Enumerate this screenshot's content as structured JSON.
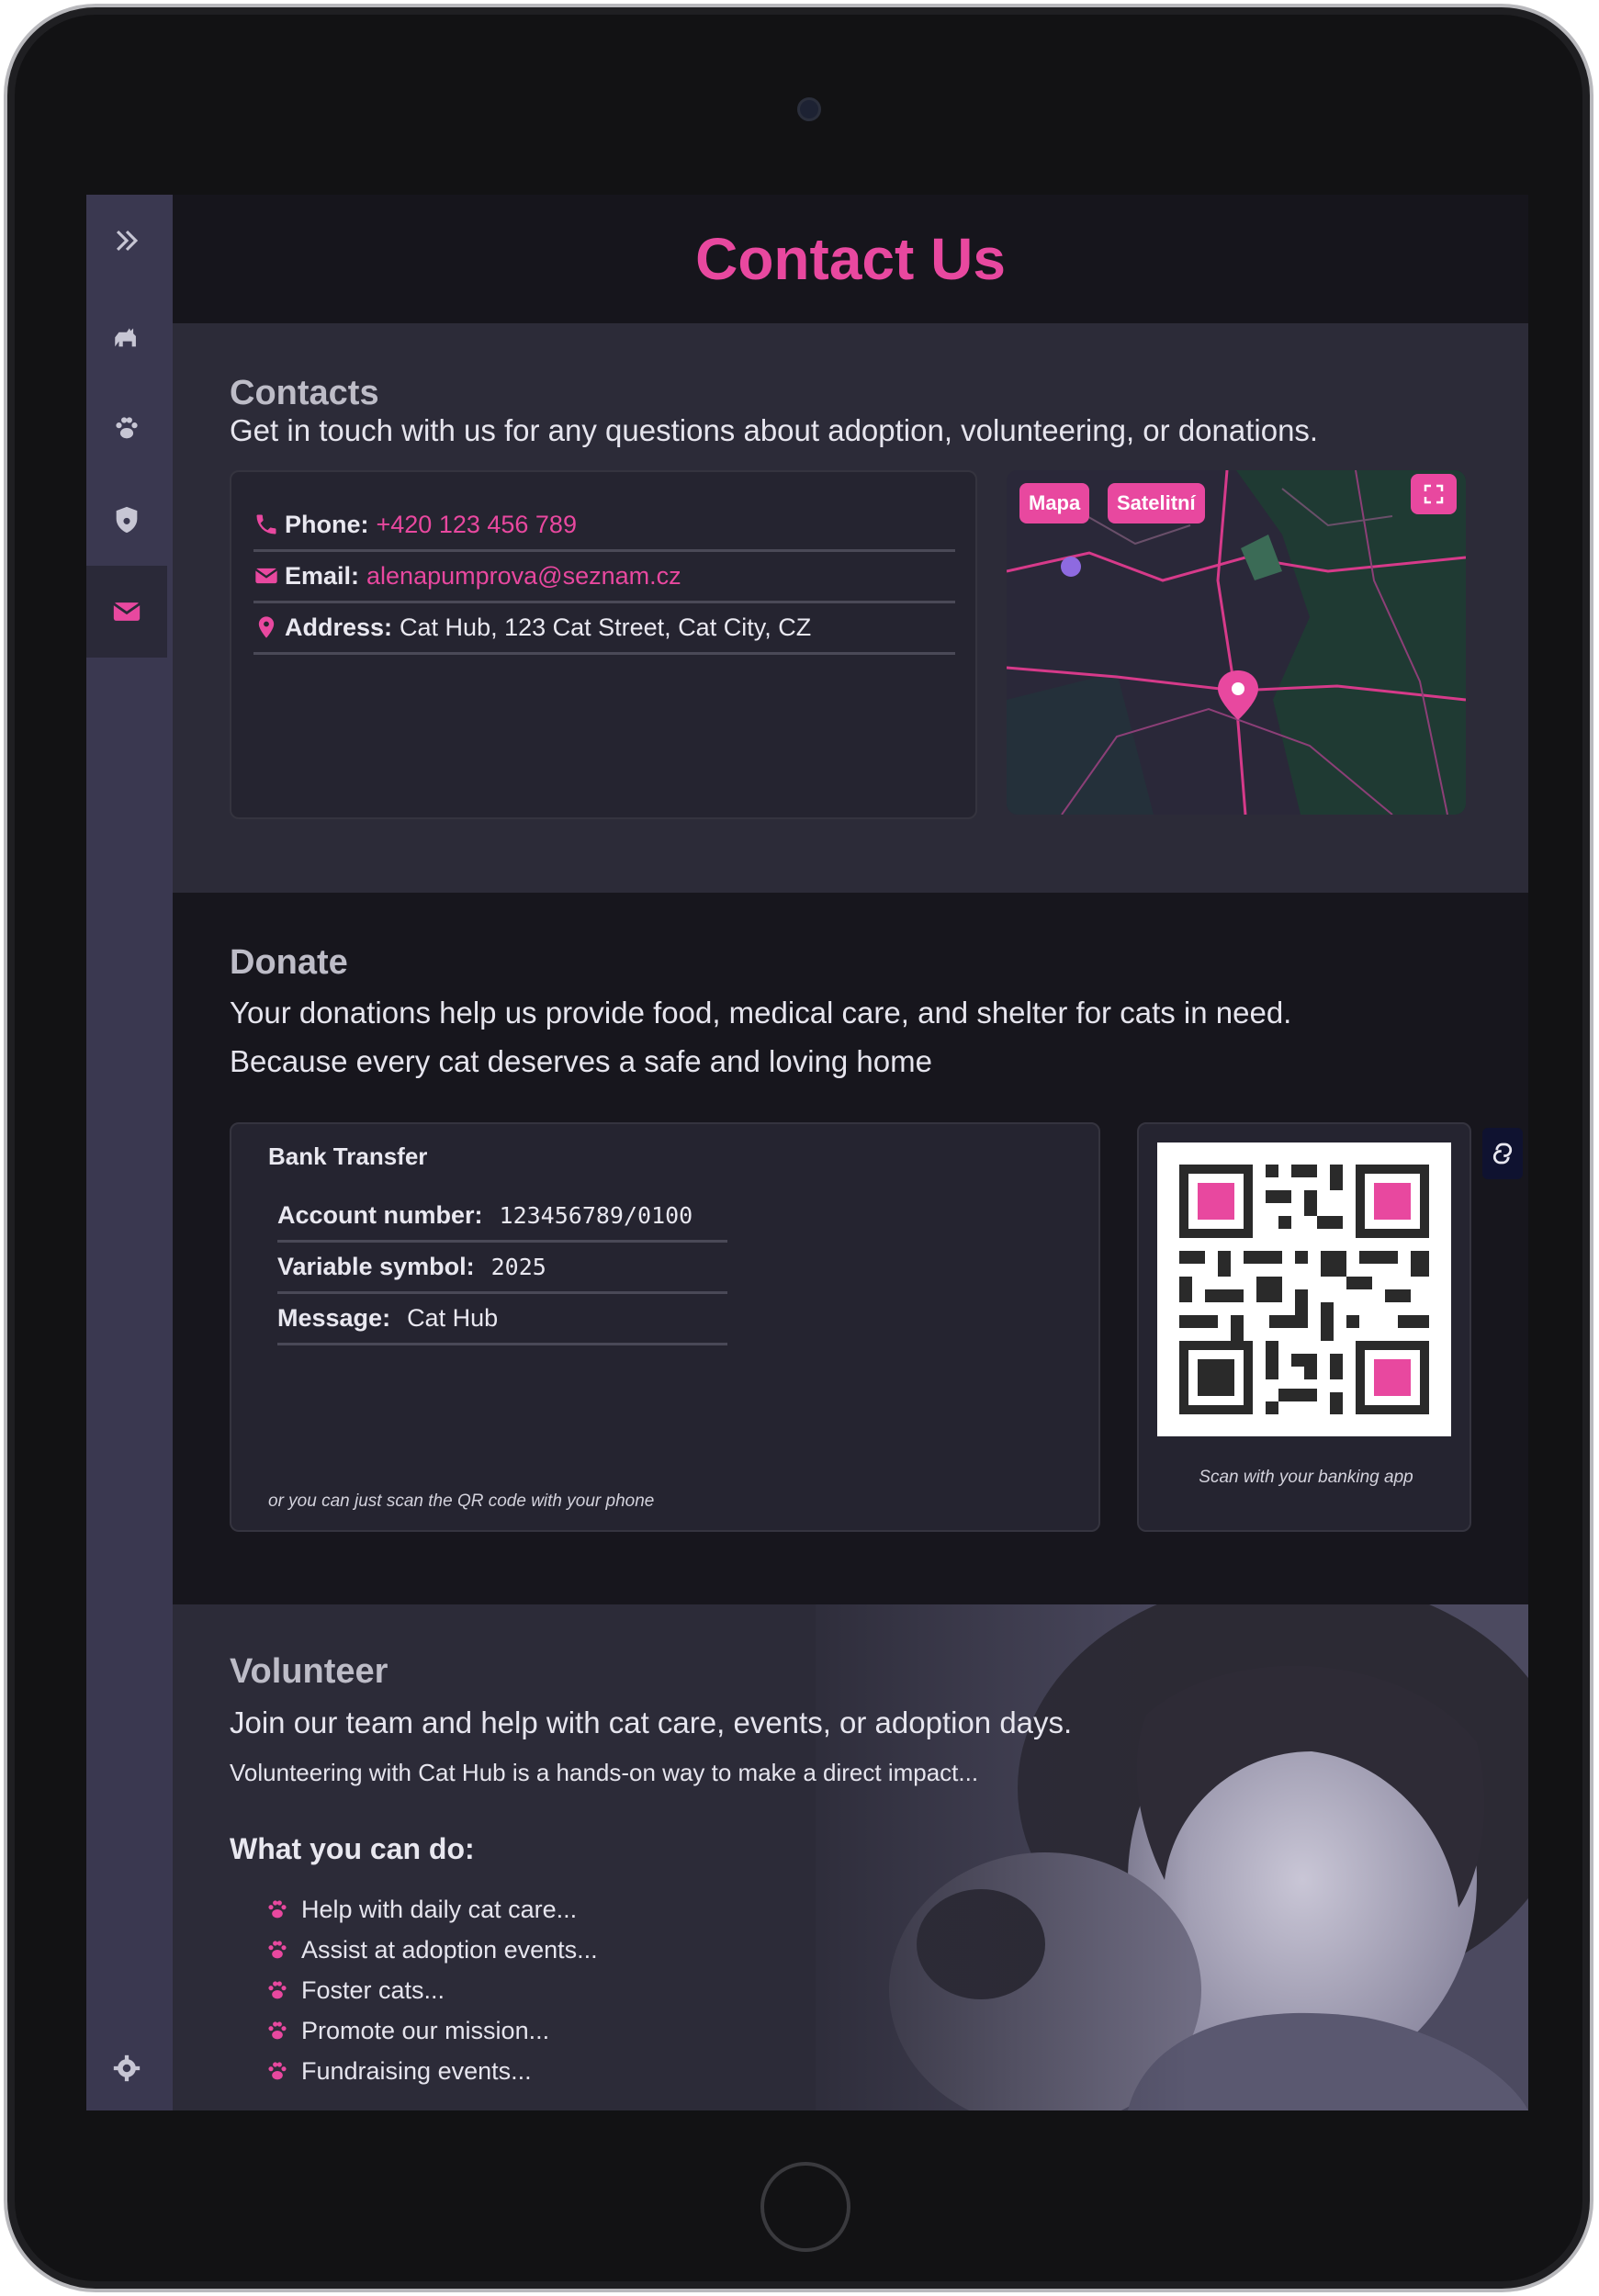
{
  "header": {
    "title": "Contact Us"
  },
  "contacts": {
    "title": "Contacts",
    "subtitle": "Get in touch with us for any questions about adoption, volunteering, or donations.",
    "phone_label": "Phone:",
    "phone_value": "+420 123 456 789",
    "email_label": "Email:",
    "email_value": "alenapumprova@seznam.cz",
    "address_label": "Address:",
    "address_value": "Cat Hub, 123 Cat Street, Cat City, CZ"
  },
  "map": {
    "btn_map": "Mapa",
    "btn_satellite": "Satelitní",
    "fullscreen_icon": "fullscreen-icon",
    "marker_icon": "paw-marker-icon"
  },
  "donate": {
    "title": "Donate",
    "line1": "Your donations help us provide food, medical care, and shelter for cats in need.",
    "line2": "Because every cat deserves a safe and loving home",
    "bank_title": "Bank Transfer",
    "account_label": "Account number:",
    "account_value": "123456789/0100",
    "vs_label": "Variable symbol:",
    "vs_value": "2025",
    "msg_label": "Message:",
    "msg_value": "Cat Hub",
    "scan_note": "or you can just scan the QR code with your phone",
    "qr_caption": "Scan with your banking app"
  },
  "volunteer": {
    "title": "Volunteer",
    "subtitle": "Join our team and help with cat care, events, or adoption days.",
    "desc": "Volunteering with Cat Hub is a hands-on way to make a direct impact...",
    "what_title": "What you can do:",
    "items": [
      "Help with daily cat care...",
      "Assist at adoption events...",
      "Foster cats...",
      "Promote our mission...",
      "Fundraising events..."
    ]
  },
  "colors": {
    "accent": "#e8489f",
    "sidebar": "#3a3850",
    "background": "#1a1920"
  }
}
